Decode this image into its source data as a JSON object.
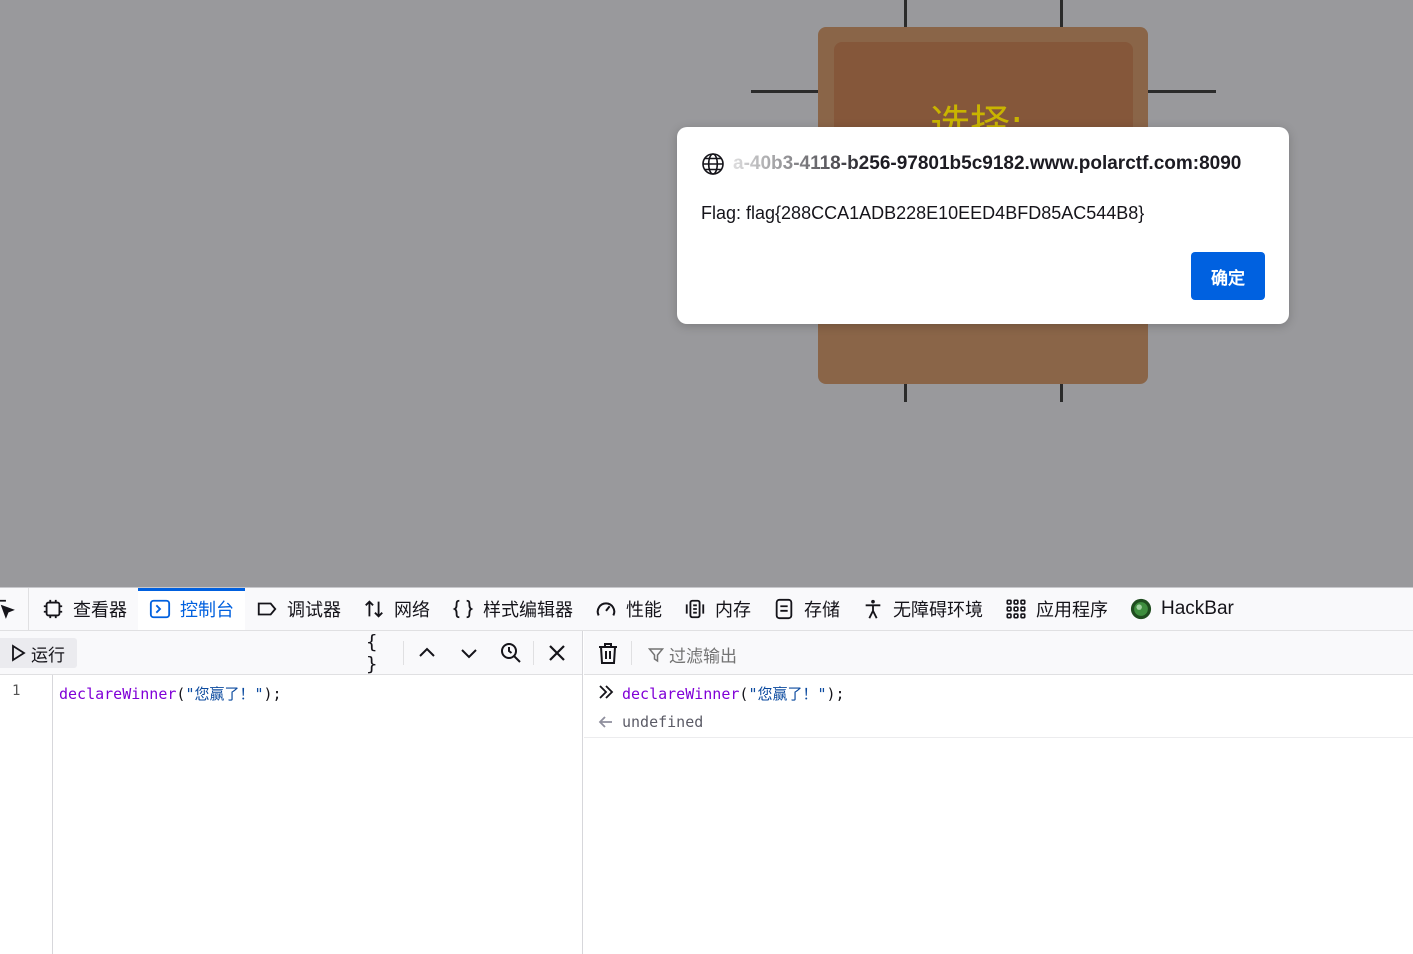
{
  "page": {
    "game": {
      "choose_label": "选择:"
    },
    "alert": {
      "origin": "a-40b3-4118-b256-97801b5c9182.www.polarctf.com:8090",
      "message": "Flag: flag{288CCA1ADB228E10EED4BFD85AC544B8}",
      "ok_label": "确定"
    }
  },
  "devtools": {
    "tabs": [
      {
        "label": "查看器",
        "icon": "inspector-icon"
      },
      {
        "label": "控制台",
        "icon": "console-icon",
        "active": true
      },
      {
        "label": "调试器",
        "icon": "debugger-icon"
      },
      {
        "label": "网络",
        "icon": "network-icon"
      },
      {
        "label": "样式编辑器",
        "icon": "style-editor-icon"
      },
      {
        "label": "性能",
        "icon": "performance-icon"
      },
      {
        "label": "内存",
        "icon": "memory-icon"
      },
      {
        "label": "存储",
        "icon": "storage-icon"
      },
      {
        "label": "无障碍环境",
        "icon": "accessibility-icon"
      },
      {
        "label": "应用程序",
        "icon": "application-icon"
      },
      {
        "label": "HackBar",
        "icon": "hackbar-icon"
      }
    ],
    "editor": {
      "run_label": "运行",
      "pretty_print_label": "{ }",
      "line_number": "1",
      "code": {
        "fn": "declareWinner",
        "open": "(",
        "arg": "\"您赢了！\"",
        "close": ");"
      }
    },
    "output": {
      "filter_placeholder": "过滤输出",
      "input": {
        "fn": "declareWinner",
        "open": "(",
        "arg": "\"您赢了！\"",
        "close": ");"
      },
      "result": "undefined"
    },
    "accent_color": "#0060df"
  }
}
